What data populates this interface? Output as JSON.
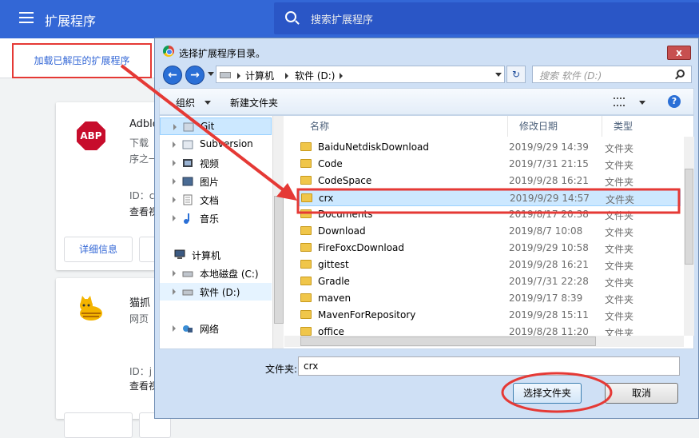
{
  "page": {
    "title": "扩展程序",
    "search_placeholder": "搜索扩展程序",
    "load_unpacked_label": "加载已解压的扩展程序"
  },
  "extensions": [
    {
      "name": "Adblo",
      "desc1": "下载",
      "desc2": "序之一",
      "id": "ID：c",
      "inspect": "查看视",
      "details_label": "详细信息",
      "logo_text": "ABP"
    },
    {
      "name": "猫抓",
      "desc1": "网页",
      "id": "ID：j",
      "inspect": "查看视"
    }
  ],
  "dialog": {
    "title": "选择扩展程序目录。",
    "close_symbol": "x",
    "address": [
      "计算机",
      "软件 (D:)"
    ],
    "search_placeholder": "搜索 软件 (D:)",
    "toolbar": {
      "organize": "组织",
      "new_folder": "新建文件夹"
    },
    "nav_items": [
      {
        "label": "Git",
        "icon": "git-icon"
      },
      {
        "label": "Subversion",
        "icon": "library-icon"
      },
      {
        "label": "视频",
        "icon": "video-icon"
      },
      {
        "label": "图片",
        "icon": "picture-icon"
      },
      {
        "label": "文档",
        "icon": "document-icon"
      },
      {
        "label": "音乐",
        "icon": "music-icon"
      },
      {
        "label": "计算机",
        "icon": "computer-icon"
      },
      {
        "label": "本地磁盘 (C:)",
        "icon": "drive-icon"
      },
      {
        "label": "软件 (D:)",
        "icon": "drive-icon"
      },
      {
        "label": "网络",
        "icon": "network-icon"
      }
    ],
    "columns": {
      "name": "名称",
      "date": "修改日期",
      "type": "类型"
    },
    "files": [
      {
        "name": "BaiduNetdiskDownload",
        "date": "2019/9/29 14:39",
        "type": "文件夹"
      },
      {
        "name": "Code",
        "date": "2019/7/31 21:15",
        "type": "文件夹"
      },
      {
        "name": "CodeSpace",
        "date": "2019/9/28 16:21",
        "type": "文件夹"
      },
      {
        "name": "crx",
        "date": "2019/9/29 14:57",
        "type": "文件夹"
      },
      {
        "name": "Documents",
        "date": "2019/8/17 20:38",
        "type": "文件夹"
      },
      {
        "name": "Download",
        "date": "2019/8/7 10:08",
        "type": "文件夹"
      },
      {
        "name": "FireFoxcDownload",
        "date": "2019/9/29 10:58",
        "type": "文件夹"
      },
      {
        "name": "gittest",
        "date": "2019/9/28 16:21",
        "type": "文件夹"
      },
      {
        "name": "Gradle",
        "date": "2019/7/31 22:28",
        "type": "文件夹"
      },
      {
        "name": "maven",
        "date": "2019/9/17 8:39",
        "type": "文件夹"
      },
      {
        "name": "MavenForRepository",
        "date": "2019/9/28 15:11",
        "type": "文件夹"
      },
      {
        "name": "office",
        "date": "2019/8/28 11:20",
        "type": "文件夹"
      }
    ],
    "folder_label": "文件夹:",
    "folder_value": "crx",
    "ok_label": "选择文件夹",
    "cancel_label": "取消"
  },
  "colors": {
    "topbar": "#3367d6",
    "annotation": "#e53935",
    "selection": "#cce8ff"
  }
}
